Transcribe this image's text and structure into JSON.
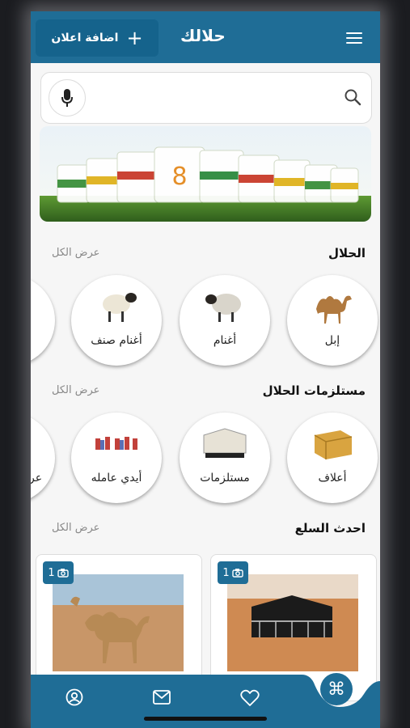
{
  "header": {
    "title": "حلالك",
    "add_label": "اضافة اعلان"
  },
  "search": {
    "placeholder": ""
  },
  "sections": {
    "livestock": {
      "title": "الحلال",
      "view_all": "عرض الكل",
      "items": [
        {
          "label": "إبل"
        },
        {
          "label": "أغنام"
        },
        {
          "label": "أغنام صنف"
        }
      ]
    },
    "supplies": {
      "title": "مستلزمات الحلال",
      "view_all": "عرض الكل",
      "items": [
        {
          "label": "أعلاف"
        },
        {
          "label": "مستلزمات"
        },
        {
          "label": "أيدي عامله"
        },
        {
          "label": "عر"
        }
      ]
    },
    "latest": {
      "title": "احدث السلع",
      "view_all": "عرض الكل",
      "cards": [
        {
          "photo_count": "1"
        },
        {
          "photo_count": "1"
        }
      ]
    }
  },
  "colors": {
    "primary": "#1f6d96",
    "primary_dark": "#15638c",
    "background": "#f6f6f6"
  },
  "icons": {
    "menu": "menu-icon",
    "add": "plus-icon",
    "mic": "mic-icon",
    "search": "search-icon",
    "camera": "camera-icon",
    "profile": "profile-icon",
    "messages": "mail-icon",
    "favorites": "heart-icon",
    "command": "command-icon"
  }
}
